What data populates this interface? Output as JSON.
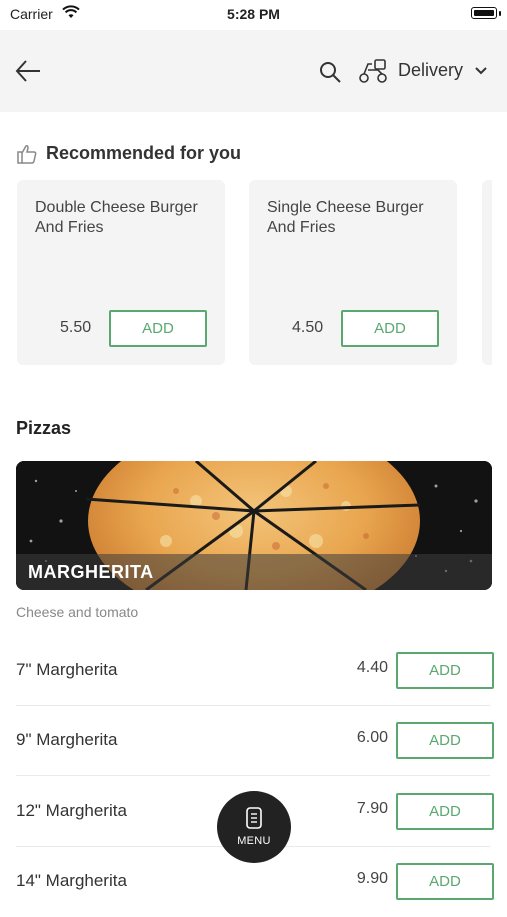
{
  "status_bar": {
    "carrier": "Carrier",
    "time": "5:28 PM"
  },
  "header": {
    "delivery_label": "Delivery"
  },
  "recommended": {
    "title": "Recommended for you",
    "cards": [
      {
        "name": "Double Cheese Burger And Fries",
        "price": "5.50",
        "add_label": "ADD"
      },
      {
        "name": "Single Cheese Burger And Fries",
        "price": "4.50",
        "add_label": "ADD"
      }
    ]
  },
  "pizzas": {
    "section_title": "Pizzas",
    "banner_label": "MARGHERITA",
    "description": "Cheese and tomato",
    "items": [
      {
        "name": "7\" Margherita",
        "price": "4.40",
        "add_label": "ADD"
      },
      {
        "name": "9\" Margherita",
        "price": "6.00",
        "add_label": "ADD"
      },
      {
        "name": "12\" Margherita",
        "price": "7.90",
        "add_label": "ADD"
      },
      {
        "name": "14\" Margherita",
        "price": "9.90",
        "add_label": "ADD"
      }
    ]
  },
  "menu_button": {
    "label": "MENU"
  },
  "colors": {
    "accent": "#5aa870",
    "header_bg": "#f4f4f4",
    "card_bg": "#f4f4f4"
  },
  "icons": [
    "back-arrow-icon",
    "search-icon",
    "scooter-icon",
    "chevron-down-icon",
    "thumbs-up-icon",
    "menu-icon",
    "wifi-icon",
    "battery-icon"
  ]
}
